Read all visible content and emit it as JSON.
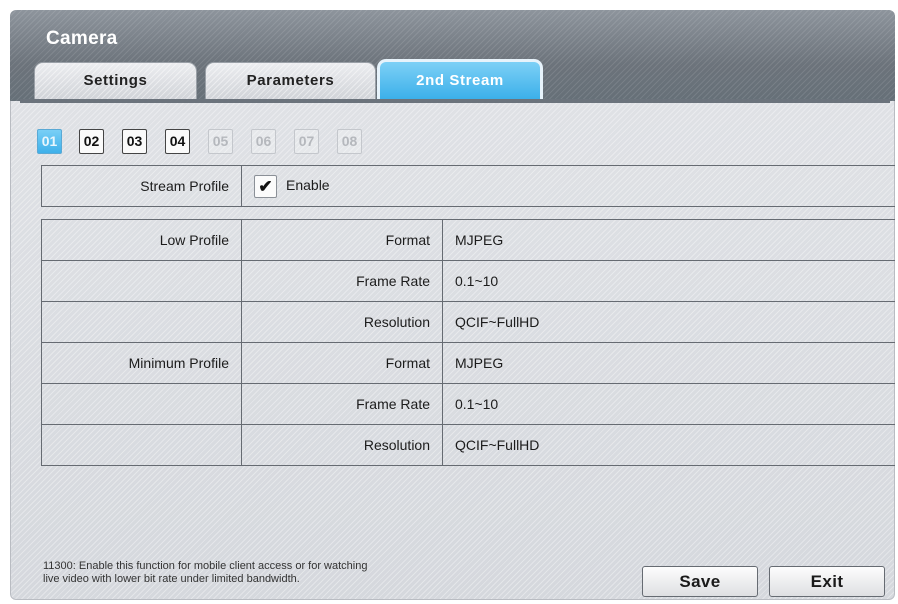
{
  "window": {
    "title": "Camera"
  },
  "tabs": [
    {
      "label": "Settings",
      "state": "inactive"
    },
    {
      "label": "Parameters",
      "state": "inactive"
    },
    {
      "label": "2nd Stream",
      "state": "active"
    }
  ],
  "channels": [
    {
      "label": "01",
      "state": "selected"
    },
    {
      "label": "02",
      "state": "enabled"
    },
    {
      "label": "03",
      "state": "enabled"
    },
    {
      "label": "04",
      "state": "enabled"
    },
    {
      "label": "05",
      "state": "disabled"
    },
    {
      "label": "06",
      "state": "disabled"
    },
    {
      "label": "07",
      "state": "disabled"
    },
    {
      "label": "08",
      "state": "disabled"
    }
  ],
  "stream_profile": {
    "label": "Stream Profile",
    "checkbox_label": "Enable",
    "checked": true
  },
  "profiles": [
    {
      "name": "Low Profile",
      "rows": [
        {
          "field": "Format",
          "value": "MJPEG"
        },
        {
          "field": "Frame Rate",
          "value": "0.1~10"
        },
        {
          "field": "Resolution",
          "value": "QCIF~FullHD"
        }
      ]
    },
    {
      "name": "Minimum Profile",
      "rows": [
        {
          "field": "Format",
          "value": "MJPEG"
        },
        {
          "field": "Frame Rate",
          "value": "0.1~10"
        },
        {
          "field": "Resolution",
          "value": "QCIF~FullHD"
        }
      ]
    }
  ],
  "footer": {
    "note_line1": "11300: Enable this function for mobile client access or for watching",
    "note_line2": "live video with lower bit rate under limited bandwidth.",
    "save_label": "Save",
    "exit_label": "Exit"
  },
  "colors": {
    "accent": "#3eb0ea",
    "titlebar": "#737a82",
    "panel": "#dcdfe3"
  }
}
